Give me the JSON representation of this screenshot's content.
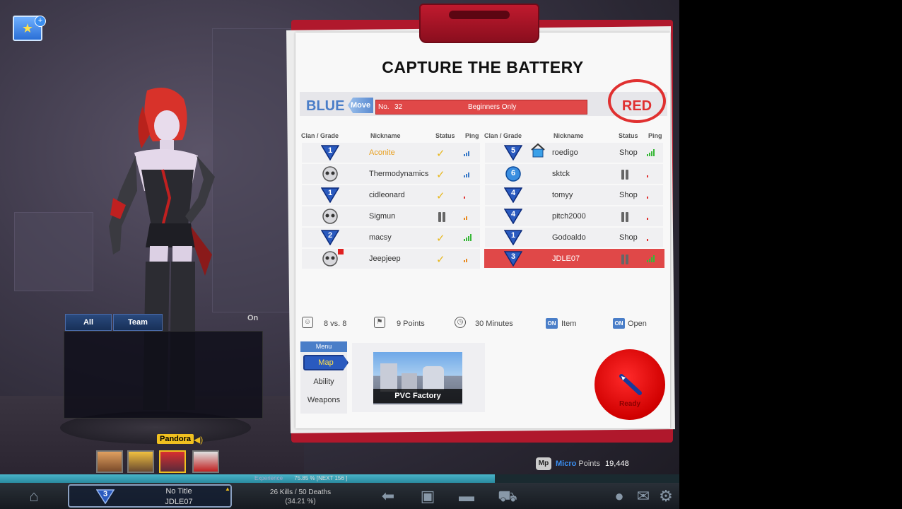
{
  "title": "CAPTURE THE BATTERY",
  "teams": {
    "blue_label": "BLUE",
    "move_label": "Move",
    "red_label": "RED"
  },
  "room": {
    "no_label": "No.",
    "number": "32",
    "name": "Beginners Only"
  },
  "headers": {
    "clan_grade": "Clan / Grade",
    "nickname": "Nickname",
    "status": "Status",
    "ping": "Ping"
  },
  "blue_players": [
    {
      "grade": "1",
      "grade_type": "triangle",
      "nickname": "Aconite",
      "status": "ready",
      "ping": 3,
      "ping_color": "#3a7ac8",
      "nick_color": "#e8a020"
    },
    {
      "grade": "",
      "grade_type": "skull",
      "nickname": "Thermodynamics",
      "status": "ready",
      "ping": 3,
      "ping_color": "#3a7ac8",
      "nick_color": "#333333"
    },
    {
      "grade": "1",
      "grade_type": "triangle",
      "nickname": "cidleonard",
      "status": "ready",
      "ping": 1,
      "ping_color": "#e03030",
      "nick_color": "#333333"
    },
    {
      "grade": "",
      "grade_type": "skull",
      "nickname": "Sigmun",
      "status": "paused",
      "ping": 2,
      "ping_color": "#e88a20",
      "nick_color": "#333333"
    },
    {
      "grade": "2",
      "grade_type": "triangle",
      "nickname": "macsy",
      "status": "ready",
      "ping": 4,
      "ping_color": "#38b838",
      "nick_color": "#333333"
    },
    {
      "grade": "",
      "grade_type": "skull",
      "nickname": "Jeepjeep",
      "status": "ready",
      "ping": 2,
      "ping_color": "#e88a20",
      "nick_color": "#333333"
    }
  ],
  "red_players": [
    {
      "grade": "5",
      "grade_type": "triangle",
      "nickname": "roedigo",
      "status": "Shop",
      "ping": 4,
      "ping_color": "#38b838",
      "nick_color": "#333333"
    },
    {
      "grade": "6",
      "grade_type": "circle",
      "nickname": "sktck",
      "status": "paused",
      "ping": 1,
      "ping_color": "#e03030",
      "nick_color": "#333333"
    },
    {
      "grade": "4",
      "grade_type": "triangle",
      "nickname": "tomyy",
      "status": "Shop",
      "ping": 1,
      "ping_color": "#e03030",
      "nick_color": "#333333"
    },
    {
      "grade": "4",
      "grade_type": "triangle",
      "nickname": "pitch2000",
      "status": "paused",
      "ping": 1,
      "ping_color": "#e03030",
      "nick_color": "#333333"
    },
    {
      "grade": "1",
      "grade_type": "triangle",
      "nickname": "Godoaldo",
      "status": "Shop",
      "ping": 1,
      "ping_color": "#e03030",
      "nick_color": "#333333"
    },
    {
      "grade": "3",
      "grade_type": "triangle",
      "nickname": "JDLE07",
      "status": "paused",
      "ping": 4,
      "ping_color": "#38b838",
      "nick_color": "#ffffff"
    }
  ],
  "room_info": {
    "players": "8 vs. 8",
    "points": "9 Points",
    "time": "30 Minutes",
    "on_tag": "ON",
    "item": "Item",
    "open": "Open"
  },
  "menu": {
    "title": "Menu",
    "map": "Map",
    "ability": "Ability",
    "weapons": "Weapons"
  },
  "map_name": "PVC Factory",
  "ready_label": "Ready",
  "chat": {
    "tab_all": "All",
    "tab_team": "Team",
    "on": "On"
  },
  "character_name": "Pandora",
  "micro_points": {
    "icon": "Mp",
    "label_micro": "Micro",
    "label_points": "Points",
    "value": "19,448"
  },
  "experience": {
    "label": "Experience",
    "text": "75.85 % [NEXT  156 ]",
    "percent": 75.85
  },
  "profile": {
    "grade": "3",
    "title": "No Title",
    "name": "JDLE07"
  },
  "stats": {
    "kills_deaths": "26 Kills / 50 Deaths",
    "ratio": "(34.21 %)"
  },
  "colors": {
    "blue_accent": "#4a7ec8",
    "red_accent": "#e03030",
    "clipboard": "#b0182c"
  }
}
